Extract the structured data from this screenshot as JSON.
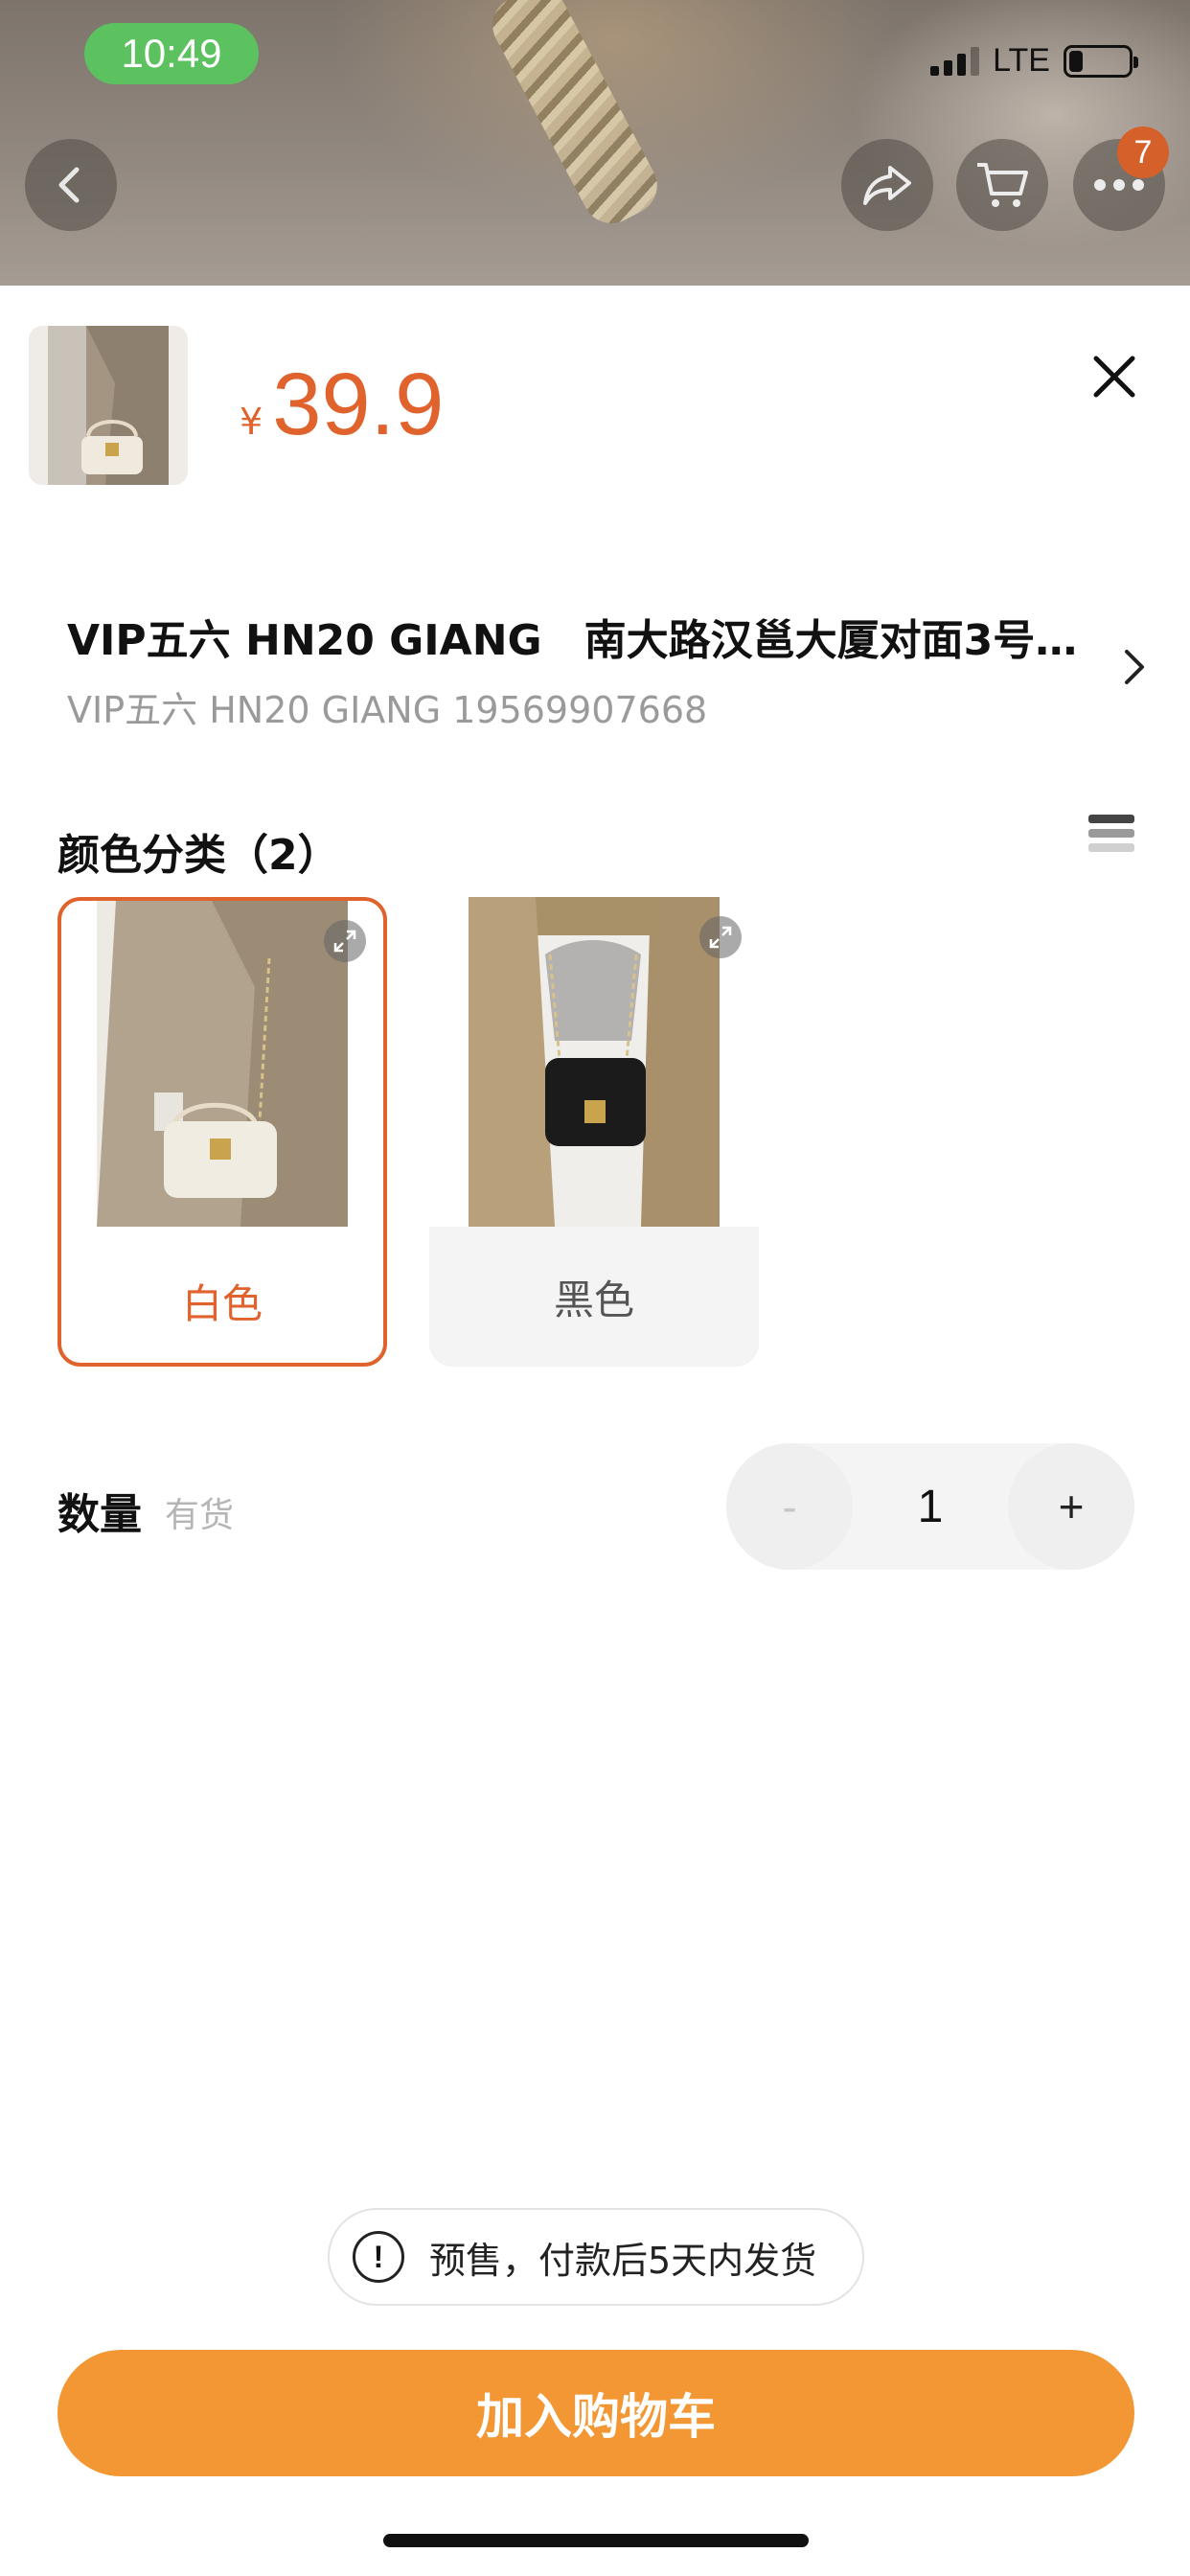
{
  "status_bar": {
    "time": "10:49",
    "network": "LTE",
    "battery_level": 0.2
  },
  "nav": {
    "cart_badge": "7"
  },
  "product": {
    "currency": "¥",
    "price": "39.9"
  },
  "address": {
    "line1": "VIP五六 HN20 GIANG　南大路汉邕大厦对面3号…",
    "line2": "VIP五六  HN20 GIANG 19569907668"
  },
  "variants": {
    "title": "颜色分类（2）",
    "options": [
      {
        "label": "白色",
        "selected": true
      },
      {
        "label": "黑色",
        "selected": false
      }
    ]
  },
  "quantity": {
    "label": "数量",
    "stock": "有货",
    "minus": "-",
    "plus": "+",
    "value": "1"
  },
  "notice": {
    "icon": "!",
    "text": "预售，付款后5天内发货"
  },
  "actions": {
    "add_to_cart": "加入购物车"
  },
  "colors": {
    "accent": "#e0622d",
    "button": "#f29734",
    "status_pill": "#5cc15f"
  }
}
